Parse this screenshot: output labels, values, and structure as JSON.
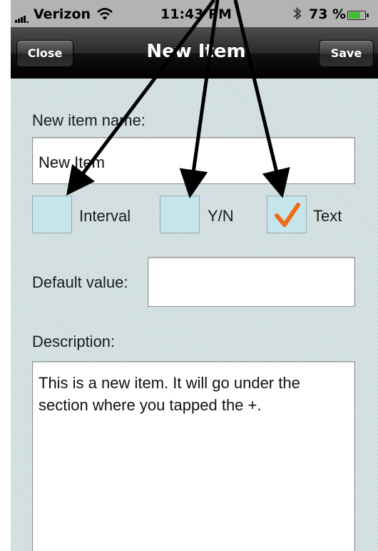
{
  "status_bar": {
    "carrier": "Verizon",
    "time": "11:43 PM",
    "battery_percent": "73 %",
    "battery_level": 0.73,
    "icons": [
      "signal-bars-icon",
      "wifi-icon",
      "bluetooth-icon",
      "battery-icon"
    ]
  },
  "nav": {
    "title": "New Item",
    "close_label": "Close",
    "save_label": "Save"
  },
  "form": {
    "name_label": "New item name:",
    "name_value": "New Item",
    "types": [
      {
        "label": "Interval",
        "checked": false
      },
      {
        "label": "Y/N",
        "checked": false
      },
      {
        "label": "Text",
        "checked": true
      }
    ],
    "default_label": "Default value:",
    "default_value": "",
    "description_label": "Description:",
    "description_value": "This is a new item. It will go under the section where you tapped the +."
  },
  "colors": {
    "nav_bar": "#1a1a1a",
    "content_background": "#d2dfe1",
    "checkbox_fill": "#c5e4eb",
    "check_mark": "#f06a16",
    "battery_fill": "#3bbf2a"
  }
}
